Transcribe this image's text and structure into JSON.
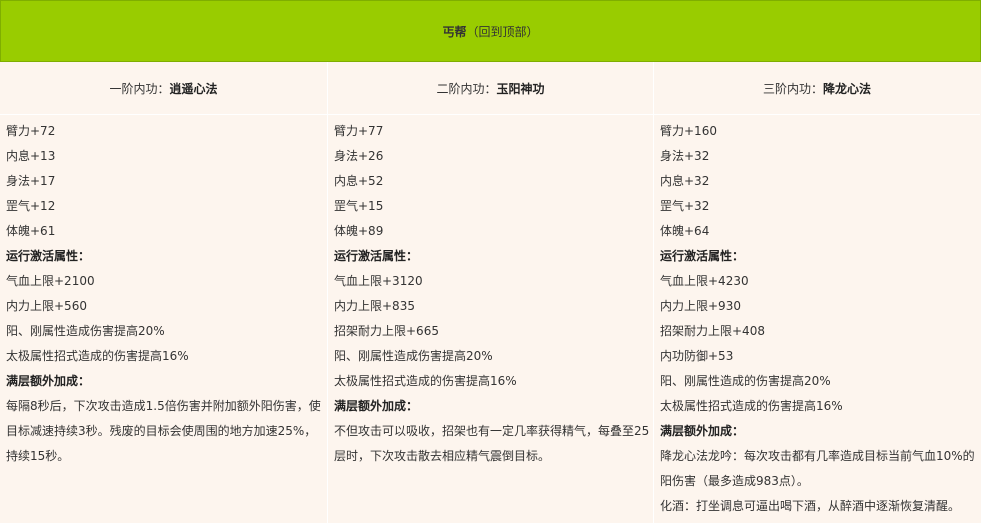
{
  "header": {
    "title": "丐帮",
    "back_link": "（回到顶部）"
  },
  "columns": [
    {
      "tier": "一阶内功：",
      "name": "逍遥心法",
      "stats": [
        "臂力+72",
        "内息+13",
        "身法+17",
        "罡气+12",
        "体魄+61"
      ],
      "run_title": "运行激活属性：",
      "run": [
        "气血上限+2100",
        "内力上限+560",
        "阳、刚属性造成伤害提高20%",
        "太极属性招式造成的伤害提高16%"
      ],
      "bonus_title": "满层额外加成：",
      "bonus": [
        "每隔8秒后，下次攻击造成1.5倍伤害并附加额外阳伤害，使目标减速持续3秒。残废的目标会使周围的地方加速25%，持续15秒。"
      ]
    },
    {
      "tier": "二阶内功：",
      "name": "玉阳神功",
      "stats": [
        "臂力+77",
        "身法+26",
        "内息+52",
        "罡气+15",
        "体魄+89"
      ],
      "run_title": "运行激活属性：",
      "run": [
        "气血上限+3120",
        "内力上限+835",
        "招架耐力上限+665",
        "阳、刚属性造成伤害提高20%",
        "太极属性招式造成的伤害提高16%"
      ],
      "bonus_title": "满层额外加成：",
      "bonus": [
        "不但攻击可以吸收，招架也有一定几率获得精气，每叠至25层时，下次攻击散去相应精气震倒目标。"
      ]
    },
    {
      "tier": "三阶内功：",
      "name": "降龙心法",
      "stats": [
        "臂力+160",
        "身法+32",
        "内息+32",
        "罡气+32",
        "体魄+64"
      ],
      "run_title": "运行激活属性：",
      "run": [
        "气血上限+4230",
        "内力上限+930",
        "招架耐力上限+408",
        "内功防御+53",
        "阳、刚属性造成的伤害提高20%",
        "太极属性招式造成的伤害提高16%"
      ],
      "bonus_title": "满层额外加成：",
      "bonus": [
        "降龙心法龙吟：每次攻击都有几率造成目标当前气血10%的阳伤害（最多造成983点）。",
        "化酒：打坐调息可逼出喝下酒，从醉酒中逐渐恢复清醒。"
      ]
    }
  ]
}
